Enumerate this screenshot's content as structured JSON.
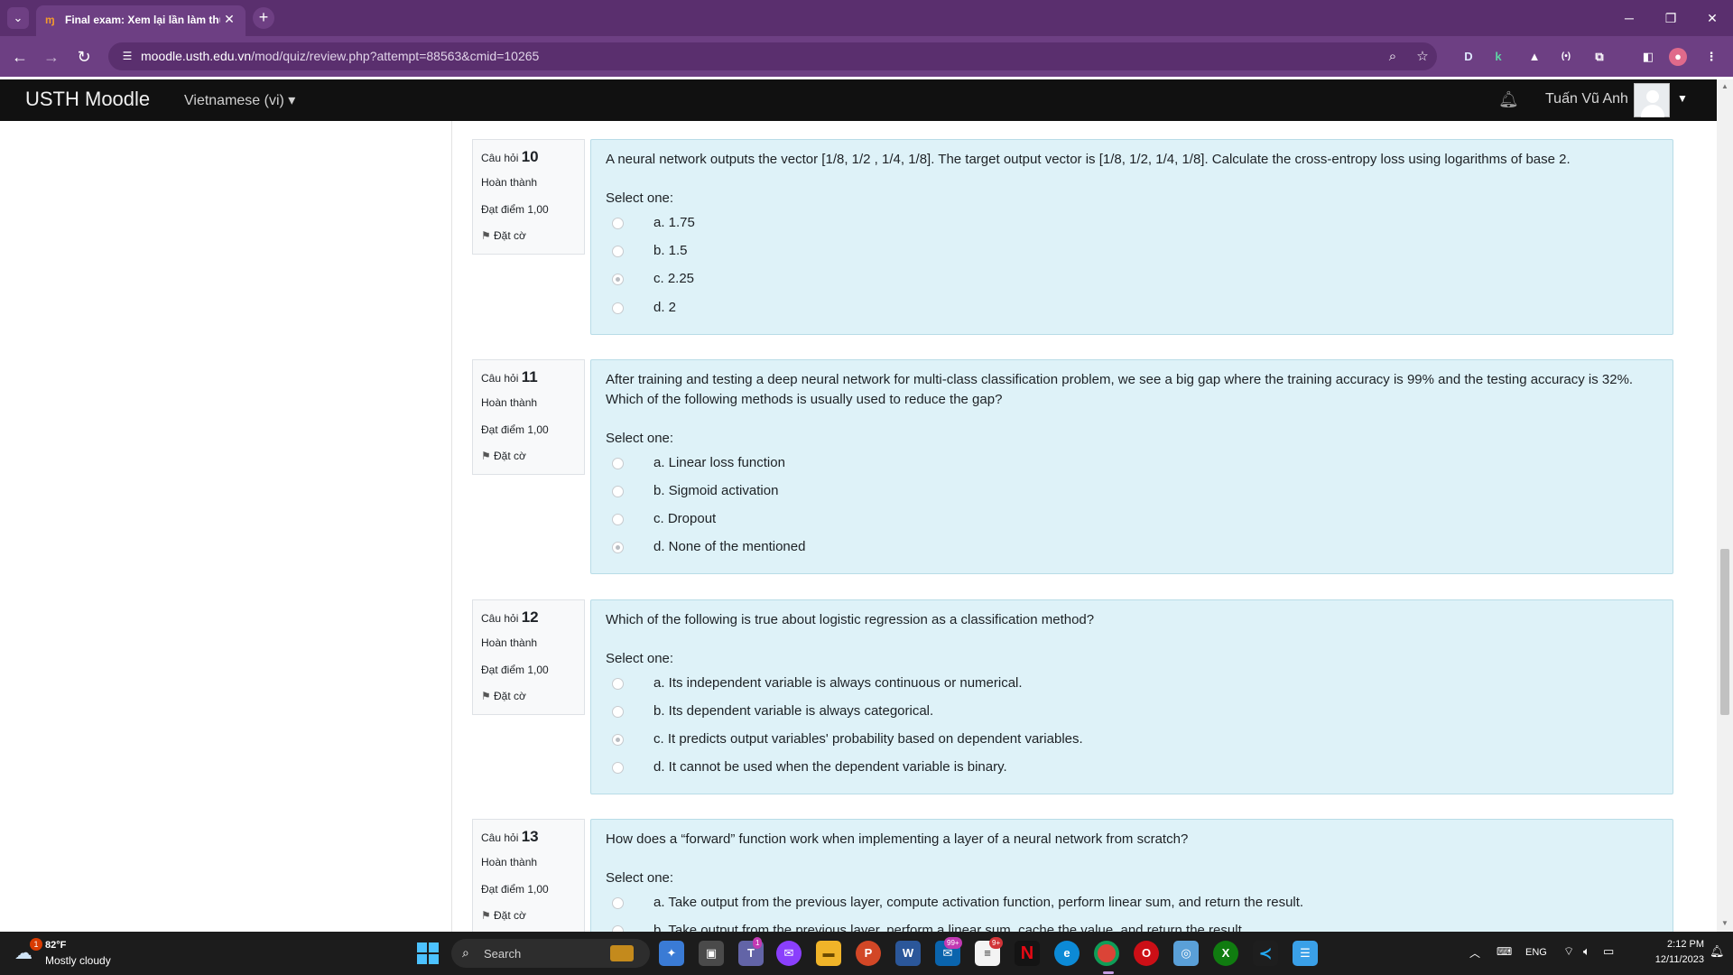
{
  "browser": {
    "tab_title": "Final exam: Xem lại lần làm thử",
    "tab_close": "✕",
    "new_tab": "+",
    "url_domain": "moodle.usth.edu.vn",
    "url_path": "/mod/quiz/review.php?attempt=88563&cmid=10265",
    "extensions": [
      "D",
      "k",
      "▲",
      "(•)",
      "⧉"
    ]
  },
  "navbar": {
    "brand": "USTH Moodle",
    "language": "Vietnamese (vi) ▾",
    "user_name": "Tuấn Vũ Anh"
  },
  "questions": [
    {
      "label": "Câu hỏi",
      "number": "10",
      "state": "Hoàn thành",
      "grade": "Đạt điểm 1,00",
      "flag": "Đặt cờ",
      "text": "A neural network outputs the vector [1/8, 1/2 , 1/4, 1/8]. The target output vector is [1/8, 1/2, 1/4, 1/8]. Calculate the cross-entropy loss using logarithms of base 2.",
      "prompt": "Select one:",
      "options": [
        "a. 1.75",
        "b. 1.5",
        "c. 2.25",
        "d. 2"
      ],
      "selected": 2
    },
    {
      "label": "Câu hỏi",
      "number": "11",
      "state": "Hoàn thành",
      "grade": "Đạt điểm 1,00",
      "flag": "Đặt cờ",
      "text": "After training and testing a deep neural network for multi-class classification problem, we see a big gap where the training accuracy is 99% and the testing accuracy is 32%. Which of the following methods is usually used to reduce the gap?",
      "prompt": "Select one:",
      "options": [
        "a. Linear loss function",
        "b. Sigmoid activation",
        "c. Dropout",
        "d. None of the mentioned"
      ],
      "selected": 3
    },
    {
      "label": "Câu hỏi",
      "number": "12",
      "state": "Hoàn thành",
      "grade": "Đạt điểm 1,00",
      "flag": "Đặt cờ",
      "text": "Which of the following is true about logistic regression as a classification method?",
      "prompt": "Select one:",
      "options": [
        "a. Its independent variable is always continuous or numerical.",
        "b. Its dependent variable is always categorical.",
        "c. It predicts output variables' probability based on dependent variables.",
        "d. It cannot be used when the dependent variable is binary."
      ],
      "selected": 2
    },
    {
      "label": "Câu hỏi",
      "number": "13",
      "state": "Hoàn thành",
      "grade": "Đạt điểm 1,00",
      "flag": "Đặt cờ",
      "text": "How does a “forward” function work when implementing a layer of a neural network from scratch?",
      "prompt": "Select one:",
      "options": [
        "a. Take output from the previous layer, compute activation function, perform linear sum, and return the result.",
        "b. Take output from the previous layer, perform a linear sum, cache the value, and return the result."
      ],
      "selected": -1
    }
  ],
  "taskbar": {
    "weather_temp": "82°F",
    "weather_cond": "Mostly cloudy",
    "weather_badge": "1",
    "search": "Search",
    "badge_teams": "1",
    "badge_mail": "99+",
    "badge_notes": "9+",
    "lang": "ENG",
    "time": "2:12 PM",
    "date": "12/11/2023"
  },
  "colors": {
    "browser_frame": "#5a2f6e",
    "navbar": "#111111",
    "question_bg": "#def2f8",
    "info_bg": "#f8f9fa"
  }
}
